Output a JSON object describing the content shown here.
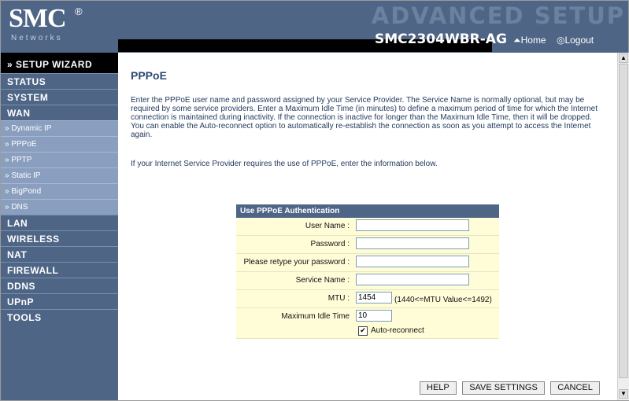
{
  "header": {
    "brand": "SMC",
    "brand_reg": "®",
    "brand_sub": "Networks",
    "banner": "ADVANCED SETUP",
    "model": "SMC2304WBR-AG",
    "home_label": "⏶Home",
    "logout_label": "◎Logout"
  },
  "sidebar": {
    "wizard": "» SETUP WIZARD",
    "items": [
      "STATUS",
      "SYSTEM",
      "WAN"
    ],
    "wan_sub": [
      "» Dynamic IP",
      "» PPPoE",
      "» PPTP",
      "» Static IP",
      "» BigPond",
      "» DNS"
    ],
    "items_after": [
      "LAN",
      "WIRELESS",
      "NAT",
      "FIREWALL",
      "DDNS",
      "UPnP",
      "TOOLS"
    ]
  },
  "main": {
    "title": "PPPoE",
    "description": "Enter the PPPoE user name and password assigned by your Service Provider. The Service Name is normally optional, but may be required by some service providers.  Enter a Maximum Idle Time (in minutes) to define a maximum period of time for which the Internet connection is maintained during inactivity.  If the connection is inactive for longer than the Maximum Idle Time, then it will be dropped.  You can enable the Auto-reconnect option to automatically re-establish the connection as soon as you attempt to access the Internet again.",
    "instruction": "If your Internet Service Provider requires the use of PPPoE, enter the information below."
  },
  "form": {
    "heading": "Use PPPoE Authentication",
    "fields": [
      {
        "label": "User Name :",
        "value": ""
      },
      {
        "label": "Password :",
        "value": ""
      },
      {
        "label": "Please retype your password :",
        "value": ""
      },
      {
        "label": "Service Name :",
        "value": ""
      }
    ],
    "mtu_label": "MTU :",
    "mtu_value": "1454",
    "mtu_range": "(1440<=MTU Value<=1492)",
    "idle_label": "Maximum Idle Time",
    "idle_value": "10",
    "auto_reconnect_label": "Auto-reconnect",
    "auto_reconnect_checked": true
  },
  "buttons": {
    "help": "HELP",
    "save": "SAVE SETTINGS",
    "cancel": "CANCEL"
  },
  "colors": {
    "header_bg": "#4e6586",
    "form_bg": "#fffdd8",
    "title": "#2c4a73"
  }
}
